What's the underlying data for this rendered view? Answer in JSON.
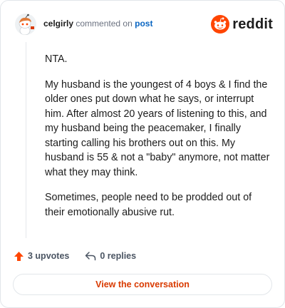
{
  "header": {
    "username": "celgirly",
    "verb": "commented on",
    "post_link": "post",
    "brand": "reddit"
  },
  "comment": {
    "paragraphs": [
      "NTA.",
      "My husband is the youngest of 4 boys & I find the older ones put down what he says, or interrupt him. After almost 20 years of listening to this, and my husband being the peacemaker, I finally starting calling his brothers out on this. My husband is 55 & not a \"baby\" anymore, not matter what they may think.",
      "Sometimes, people need to be prodded out of their emotionally abusive rut."
    ]
  },
  "actions": {
    "upvotes": "3 upvotes",
    "replies": "0 replies"
  },
  "view_button": "View the conversation",
  "colors": {
    "accent": "#ff4500",
    "button_text": "#d93a00",
    "link": "#0a66c2"
  },
  "icons": {
    "avatar": "snoo-avatar-icon",
    "brand": "reddit-logo-icon",
    "upvote": "upvote-arrow-icon",
    "reply": "reply-arrow-icon"
  }
}
